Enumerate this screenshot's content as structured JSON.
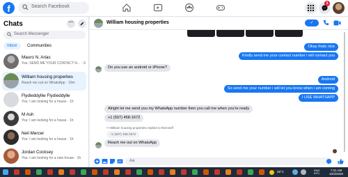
{
  "topbar": {
    "logo": "f",
    "search_placeholder": "Search Facebook",
    "notification_count": "1",
    "icons": [
      "home-icon",
      "video-icon",
      "groups-icon",
      "gaming-icon",
      "menu-grid-icon",
      "messenger-icon",
      "bell-icon"
    ],
    "accent": "#1877f2"
  },
  "chats": {
    "title": "Chats",
    "search_placeholder": "Search Messenger",
    "tabs": [
      {
        "label": "Inbox"
      },
      {
        "label": "Communities"
      }
    ],
    "items": [
      {
        "name": "Mauro N. Arias",
        "preview": "You: SEND ME YOUR CONTACT N... · 10m"
      },
      {
        "name": "William housing properties",
        "preview": "Reach me out on WhatsApp · 10m"
      },
      {
        "name": "Flydieddyllie Flydieddylle",
        "preview": "You: I am looking for a house · 1h"
      },
      {
        "name": "M Ash",
        "preview": "You: I am looking for a house · 1h"
      },
      {
        "name": "Neil Mercer",
        "preview": "You: I am looking for a house · 1h"
      },
      {
        "name": "Jordan Cocksey",
        "preview": "You: I am looking for a new house · 1h"
      }
    ]
  },
  "conversation": {
    "name": "William housing properties",
    "header_button": "✓",
    "messages": [
      {
        "dir": "out",
        "text": "Okay thats nice"
      },
      {
        "dir": "out",
        "text": "Kindly send me your contact number i will contact you"
      },
      {
        "dir": "in",
        "text": "Do you use an android or iPhone?"
      },
      {
        "dir": "out",
        "text": "Android"
      },
      {
        "dir": "out",
        "text": "So send me your number i will let you know when i am coming"
      },
      {
        "dir": "out",
        "text": "I USE WHATSAPP"
      },
      {
        "dir": "in",
        "text": "Alright let me send you my WhatsApp number then you call me when you're ready"
      },
      {
        "dir": "in",
        "text": "+1 (507) 458-1672"
      },
      {
        "dir": "in",
        "text": "Reach me out on WhatsApp"
      }
    ],
    "reply_note": "William housing properties replied to themself",
    "reply_quote": "+1 (507) 458-1672",
    "composer_placeholder": "Aa"
  },
  "taskbar": {
    "weather": "26°C",
    "lang_top": "ENG",
    "lang_bottom": "INTL",
    "time": "7:31 AM",
    "date": "10/3/2025"
  }
}
